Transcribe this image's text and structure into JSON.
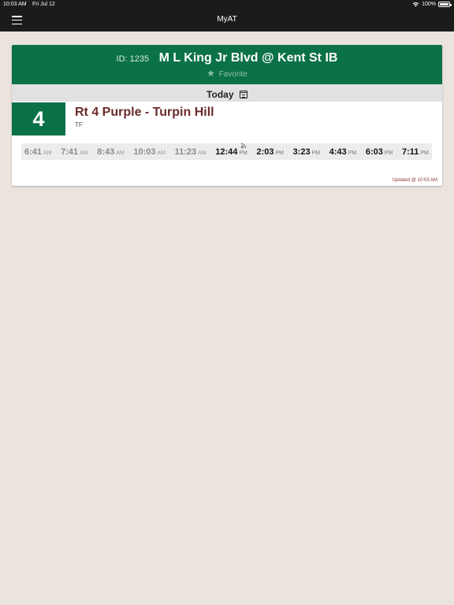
{
  "status_bar": {
    "time": "10:03 AM",
    "date": "Fri Jul 12",
    "battery": "100%"
  },
  "nav": {
    "title": "MyAT"
  },
  "stop": {
    "id_label": "ID: 1235",
    "name": "M L King Jr Blvd @ Kent St IB",
    "favorite_label": "Favorite"
  },
  "day": {
    "label": "Today"
  },
  "route": {
    "number": "4",
    "name": "Rt 4 Purple - Turpin Hill",
    "sub": "TF"
  },
  "times": [
    {
      "time": "6:41",
      "ampm": "AM",
      "state": "past"
    },
    {
      "time": "7:41",
      "ampm": "AM",
      "state": "past"
    },
    {
      "time": "8:43",
      "ampm": "AM",
      "state": "past"
    },
    {
      "time": "10:03",
      "ampm": "AM",
      "state": "past"
    },
    {
      "time": "11:23",
      "ampm": "AM",
      "state": "past"
    },
    {
      "time": "12:44",
      "ampm": "PM",
      "state": "future",
      "realtime": true
    },
    {
      "time": "2:03",
      "ampm": "PM",
      "state": "future"
    },
    {
      "time": "3:23",
      "ampm": "PM",
      "state": "future"
    },
    {
      "time": "4:43",
      "ampm": "PM",
      "state": "future"
    },
    {
      "time": "6:03",
      "ampm": "PM",
      "state": "future"
    },
    {
      "time": "7:11",
      "ampm": "PM",
      "state": "future"
    }
  ],
  "updated": "Updated @ 10:03 AM",
  "colors": {
    "brand_green": "#0b7146",
    "route_name": "#6b2a2a",
    "background": "#ebe3de",
    "bar": "#1b1b1b"
  },
  "icons": {
    "menu": "hamburger-menu-icon",
    "favorite": "star-icon",
    "calendar": "calendar-icon",
    "realtime": "realtime-signal-icon",
    "wifi": "wifi-icon",
    "battery": "battery-icon"
  }
}
